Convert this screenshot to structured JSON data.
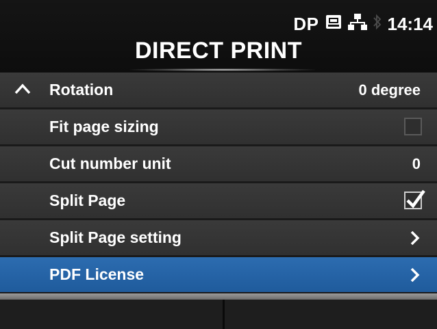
{
  "status": {
    "mode": "DP",
    "time": "14:14",
    "icons": [
      "sd-card-icon",
      "network-icon",
      "bluetooth-icon"
    ]
  },
  "header": {
    "title": "DIRECT PRINT"
  },
  "menu": {
    "items": [
      {
        "label": "Rotation",
        "value": "0 degree"
      },
      {
        "label": "Fit page sizing",
        "checked": false
      },
      {
        "label": "Cut number unit",
        "value": "0"
      },
      {
        "label": "Split Page",
        "checked": true
      },
      {
        "label": "Split Page setting"
      },
      {
        "label": "PDF License",
        "selected": true
      }
    ]
  },
  "colors": {
    "background": "#1a1a1a",
    "row": "#353535",
    "selected": "#2462a6",
    "text": "#ffffff"
  }
}
